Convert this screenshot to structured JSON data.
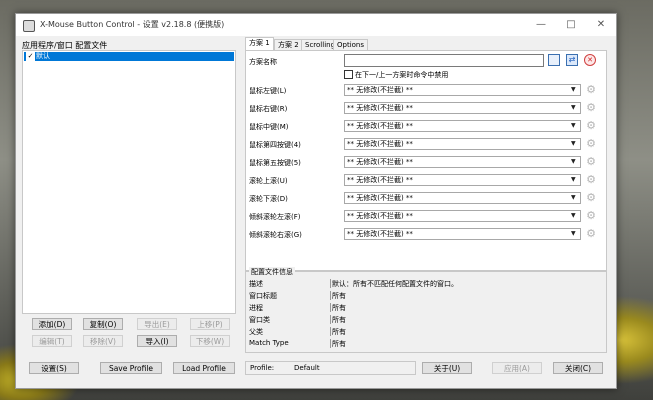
{
  "window": {
    "title": "X-Mouse Button Control - 设置 v2.18.8 (便携版)"
  },
  "left": {
    "header": "应用程序/窗口 配置文件",
    "list": [
      {
        "label": "默认",
        "checked": true
      }
    ],
    "buttons": {
      "add": "添加(D)",
      "copy": "复制(O)",
      "export": "导出(E)",
      "move_up": "上移(P)",
      "edit": "编辑(T)",
      "remove": "移除(V)",
      "import": "导入(I)",
      "move_down": "下移(W)"
    }
  },
  "tabs": [
    "方案 1",
    "方案 2",
    "Scrolling",
    "Options"
  ],
  "layer": {
    "name_label": "方案名称",
    "name_value": "",
    "checkbox_label": "在下一/上一方案时命令中禁用",
    "rows": [
      {
        "label": "鼠标左键(L)",
        "value": "** 无修改(不拦截) **"
      },
      {
        "label": "鼠标右键(R)",
        "value": "** 无修改(不拦截) **"
      },
      {
        "label": "鼠标中键(M)",
        "value": "** 无修改(不拦截) **"
      },
      {
        "label": "鼠标第四按键(4)",
        "value": "** 无修改(不拦截) **"
      },
      {
        "label": "鼠标第五按键(5)",
        "value": "** 无修改(不拦截) **"
      },
      {
        "label": "滚轮上滚(U)",
        "value": "** 无修改(不拦截) **"
      },
      {
        "label": "滚轮下滚(D)",
        "value": "** 无修改(不拦截) **"
      },
      {
        "label": "倾斜滚轮左滚(F)",
        "value": "** 无修改(不拦截) **"
      },
      {
        "label": "倾斜滚轮右滚(G)",
        "value": "** 无修改(不拦截) **"
      }
    ]
  },
  "profile_info": {
    "header": "配置文件信息",
    "rows": [
      {
        "key": "描述",
        "value": "默认：所有不匹配任何配置文件的窗口。"
      },
      {
        "key": "窗口标题",
        "value": "所有"
      },
      {
        "key": "进程",
        "value": "所有"
      },
      {
        "key": "窗口类",
        "value": "所有"
      },
      {
        "key": "父类",
        "value": "所有"
      },
      {
        "key": "Match Type",
        "value": "所有"
      }
    ]
  },
  "bottom": {
    "settings": "设置(S)",
    "save_profile": "Save Profile",
    "load_profile": "Load Profile",
    "profile_label": "Profile:",
    "profile_value": "Default",
    "about": "关于(U)",
    "apply": "应用(A)",
    "close": "关闭(C)"
  }
}
